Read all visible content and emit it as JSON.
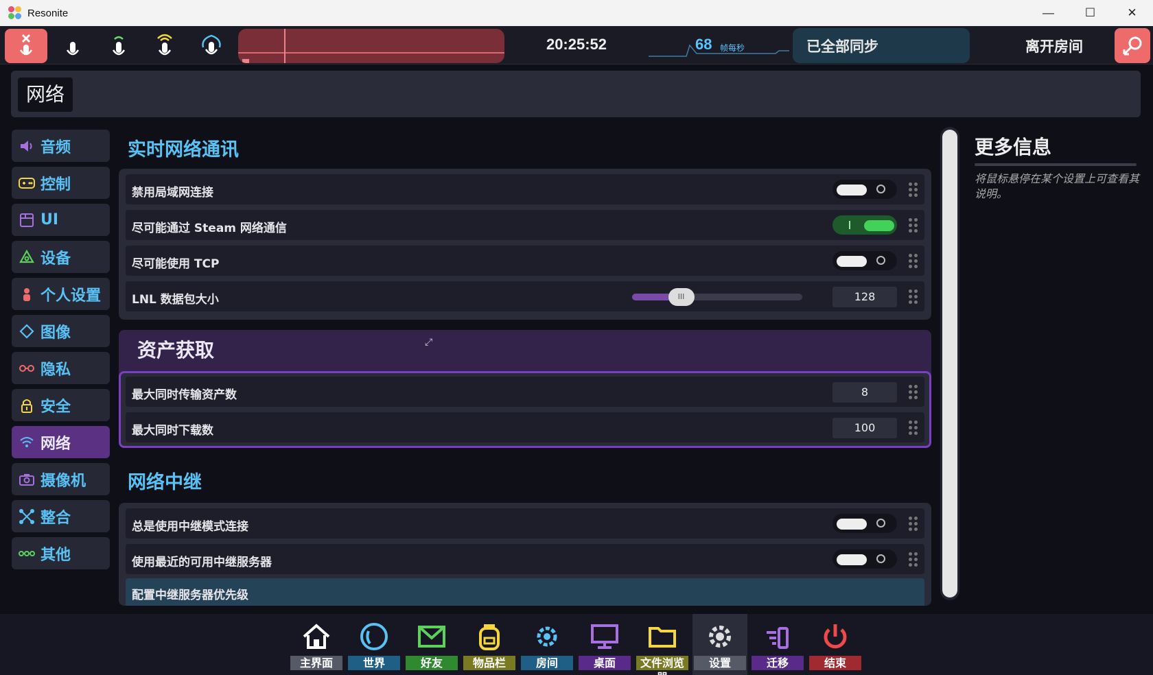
{
  "window": {
    "title": "Resonite"
  },
  "topbar": {
    "clock": "20:25:52",
    "fps": "68",
    "fps_unit": "帧每秒",
    "sync_status": "已全部同步",
    "leave_label": "离开房间"
  },
  "header": {
    "title": "网络"
  },
  "sidebar": {
    "items": [
      {
        "label": "音频",
        "icon": "speaker-icon"
      },
      {
        "label": "控制",
        "icon": "gamepad-icon"
      },
      {
        "label": "UI",
        "icon": "window-icon"
      },
      {
        "label": "设备",
        "icon": "device-icon"
      },
      {
        "label": "个人设置",
        "icon": "person-icon"
      },
      {
        "label": "图像",
        "icon": "diamond-icon"
      },
      {
        "label": "隐私",
        "icon": "glasses-icon"
      },
      {
        "label": "安全",
        "icon": "lock-icon"
      },
      {
        "label": "网络",
        "icon": "wifi-icon"
      },
      {
        "label": "摄像机",
        "icon": "camera-icon"
      },
      {
        "label": "整合",
        "icon": "integration-icon"
      },
      {
        "label": "其他",
        "icon": "dots-icon"
      }
    ]
  },
  "main": {
    "realtime": {
      "title": "实时网络通讯",
      "rows": [
        {
          "label": "禁用局域网连接",
          "on": false
        },
        {
          "label": "尽可能通过 Steam 网络通信",
          "on": true
        },
        {
          "label": "尽可能使用 TCP",
          "on": false
        }
      ],
      "lnl": {
        "label": "LNL 数据包大小",
        "value": "128",
        "slider_fraction": 0.25
      }
    },
    "assets": {
      "title": "资产获取",
      "rows": [
        {
          "label": "最大同时传输资产数",
          "value": "8"
        },
        {
          "label": "最大同时下载数",
          "value": "100"
        }
      ]
    },
    "relay": {
      "title": "网络中继",
      "rows": [
        {
          "label": "总是使用中继模式连接",
          "on": false
        },
        {
          "label": "使用最近的可用中继服务器",
          "on": false
        }
      ],
      "priority_label": "配置中继服务器优先级"
    }
  },
  "info": {
    "title": "更多信息",
    "text": "将鼠标悬停在某个设置上可查看其说明。"
  },
  "dock": {
    "items": [
      {
        "label": "主界面",
        "color": "#555a66"
      },
      {
        "label": "世界",
        "color": "#1f5f86"
      },
      {
        "label": "好友",
        "color": "#2f8a2f"
      },
      {
        "label": "物品栏",
        "color": "#7a7a22"
      },
      {
        "label": "房间",
        "color": "#1f5f86"
      },
      {
        "label": "桌面",
        "color": "#5a2a8a"
      },
      {
        "label": "文件浏览器",
        "color": "#7a7a22"
      },
      {
        "label": "设置",
        "color": "#555a66"
      },
      {
        "label": "迁移",
        "color": "#5a2a8a"
      },
      {
        "label": "结束",
        "color": "#a02a30"
      }
    ]
  }
}
